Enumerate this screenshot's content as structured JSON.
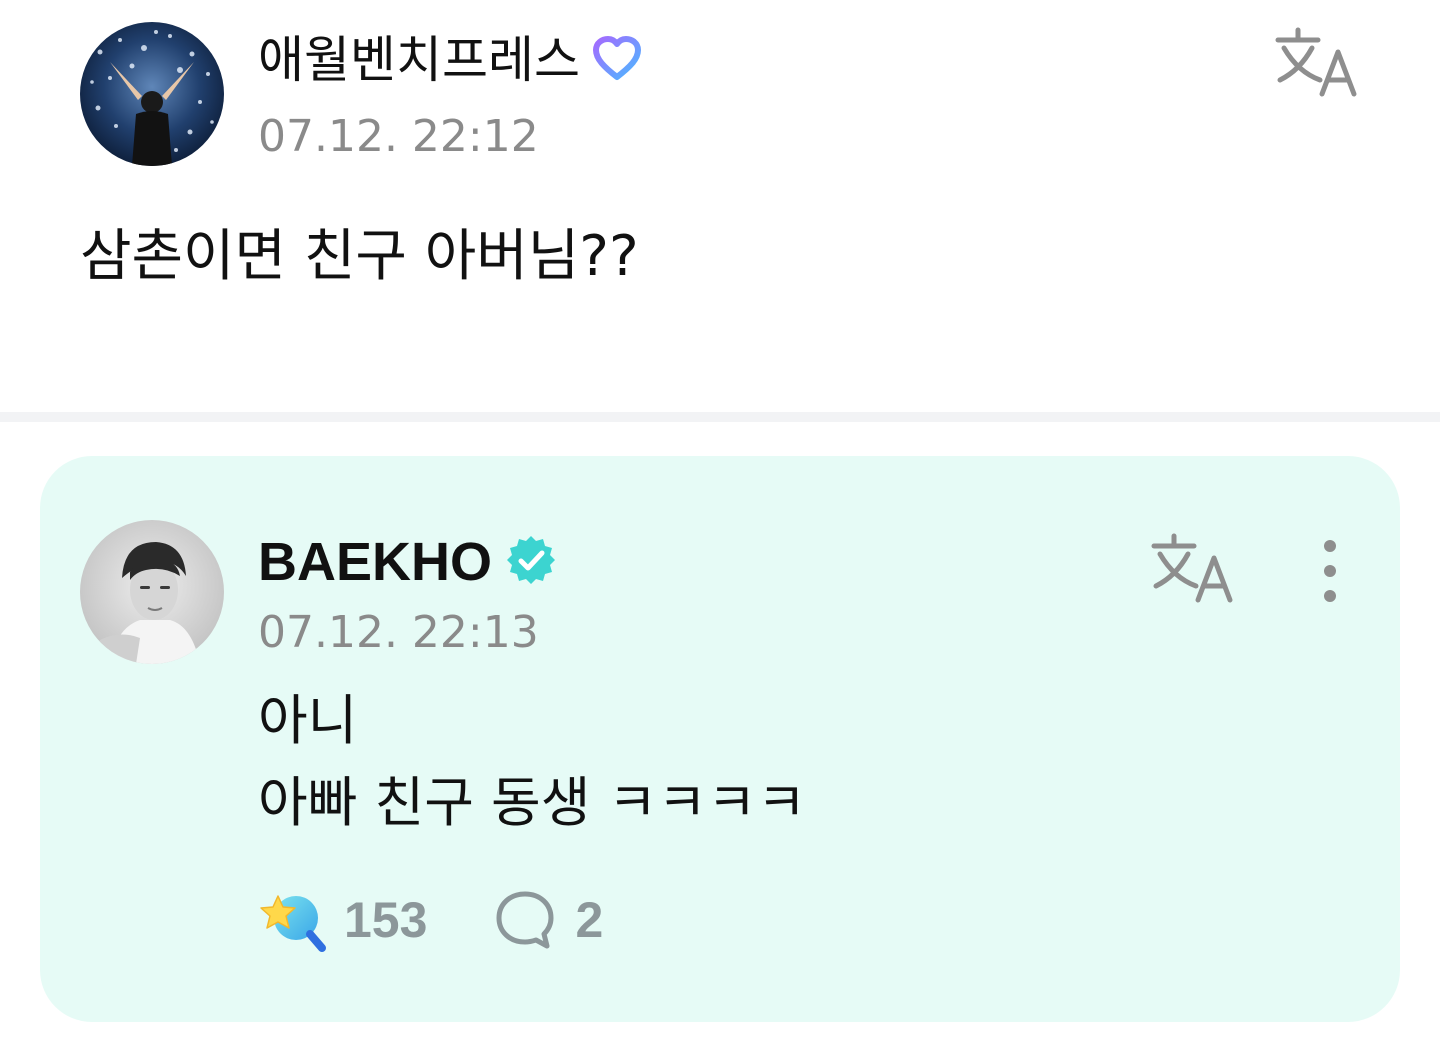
{
  "post": {
    "author": "애월벤치프레스",
    "author_badge_icon": "fan-membership-badge-icon",
    "timestamp": "07.12. 22:12",
    "text": "삼촌이면 친구 아버님??",
    "translate_icon": "translate-icon"
  },
  "reply": {
    "author": "BAEKHO",
    "author_badge_icon": "verified-badge-icon",
    "timestamp": "07.12. 22:13",
    "lines": [
      "아니",
      "아빠 친구 동생 ㅋㅋㅋㅋ"
    ],
    "translate_icon": "translate-icon",
    "more_icon": "more-vertical-icon",
    "likes": "153",
    "comments": "2"
  },
  "colors": {
    "reply_background": "#e6fbf6",
    "timestamp": "#8a8a8a",
    "count": "#8c979a",
    "verified": "#3cd4d0"
  }
}
